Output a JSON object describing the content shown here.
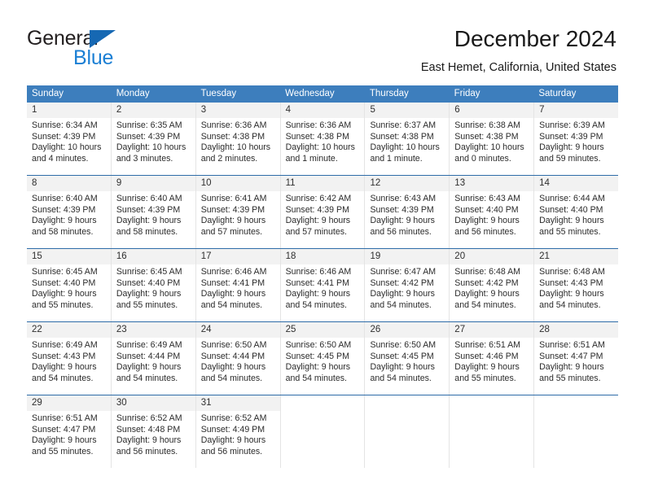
{
  "brand": {
    "name_part1": "General",
    "name_part2": "Blue",
    "triangle_icon": "blue-triangle-icon",
    "accent_color": "#1668b3",
    "accent_color_light": "#1b7fd4"
  },
  "header": {
    "title": "December 2024",
    "subtitle": "East Hemet, California, United States"
  },
  "theme": {
    "header_row_bg": "#3d7ebd",
    "header_row_text": "#ffffff",
    "daynum_bg": "#f2f2f2",
    "cell_border": "#e4e4e4",
    "week_divider": "#2e6ca8",
    "body_text": "#2b2b2b"
  },
  "weekdays": [
    "Sunday",
    "Monday",
    "Tuesday",
    "Wednesday",
    "Thursday",
    "Friday",
    "Saturday"
  ],
  "labels": {
    "sunrise_prefix": "Sunrise:",
    "sunset_prefix": "Sunset:",
    "daylight_prefix": "Daylight:"
  },
  "weeks": [
    [
      {
        "day": "1",
        "sunrise": "Sunrise: 6:34 AM",
        "sunset": "Sunset: 4:39 PM",
        "daylight_1": "Daylight: 10 hours",
        "daylight_2": "and 4 minutes."
      },
      {
        "day": "2",
        "sunrise": "Sunrise: 6:35 AM",
        "sunset": "Sunset: 4:39 PM",
        "daylight_1": "Daylight: 10 hours",
        "daylight_2": "and 3 minutes."
      },
      {
        "day": "3",
        "sunrise": "Sunrise: 6:36 AM",
        "sunset": "Sunset: 4:38 PM",
        "daylight_1": "Daylight: 10 hours",
        "daylight_2": "and 2 minutes."
      },
      {
        "day": "4",
        "sunrise": "Sunrise: 6:36 AM",
        "sunset": "Sunset: 4:38 PM",
        "daylight_1": "Daylight: 10 hours",
        "daylight_2": "and 1 minute."
      },
      {
        "day": "5",
        "sunrise": "Sunrise: 6:37 AM",
        "sunset": "Sunset: 4:38 PM",
        "daylight_1": "Daylight: 10 hours",
        "daylight_2": "and 1 minute."
      },
      {
        "day": "6",
        "sunrise": "Sunrise: 6:38 AM",
        "sunset": "Sunset: 4:38 PM",
        "daylight_1": "Daylight: 10 hours",
        "daylight_2": "and 0 minutes."
      },
      {
        "day": "7",
        "sunrise": "Sunrise: 6:39 AM",
        "sunset": "Sunset: 4:39 PM",
        "daylight_1": "Daylight: 9 hours",
        "daylight_2": "and 59 minutes."
      }
    ],
    [
      {
        "day": "8",
        "sunrise": "Sunrise: 6:40 AM",
        "sunset": "Sunset: 4:39 PM",
        "daylight_1": "Daylight: 9 hours",
        "daylight_2": "and 58 minutes."
      },
      {
        "day": "9",
        "sunrise": "Sunrise: 6:40 AM",
        "sunset": "Sunset: 4:39 PM",
        "daylight_1": "Daylight: 9 hours",
        "daylight_2": "and 58 minutes."
      },
      {
        "day": "10",
        "sunrise": "Sunrise: 6:41 AM",
        "sunset": "Sunset: 4:39 PM",
        "daylight_1": "Daylight: 9 hours",
        "daylight_2": "and 57 minutes."
      },
      {
        "day": "11",
        "sunrise": "Sunrise: 6:42 AM",
        "sunset": "Sunset: 4:39 PM",
        "daylight_1": "Daylight: 9 hours",
        "daylight_2": "and 57 minutes."
      },
      {
        "day": "12",
        "sunrise": "Sunrise: 6:43 AM",
        "sunset": "Sunset: 4:39 PM",
        "daylight_1": "Daylight: 9 hours",
        "daylight_2": "and 56 minutes."
      },
      {
        "day": "13",
        "sunrise": "Sunrise: 6:43 AM",
        "sunset": "Sunset: 4:40 PM",
        "daylight_1": "Daylight: 9 hours",
        "daylight_2": "and 56 minutes."
      },
      {
        "day": "14",
        "sunrise": "Sunrise: 6:44 AM",
        "sunset": "Sunset: 4:40 PM",
        "daylight_1": "Daylight: 9 hours",
        "daylight_2": "and 55 minutes."
      }
    ],
    [
      {
        "day": "15",
        "sunrise": "Sunrise: 6:45 AM",
        "sunset": "Sunset: 4:40 PM",
        "daylight_1": "Daylight: 9 hours",
        "daylight_2": "and 55 minutes."
      },
      {
        "day": "16",
        "sunrise": "Sunrise: 6:45 AM",
        "sunset": "Sunset: 4:40 PM",
        "daylight_1": "Daylight: 9 hours",
        "daylight_2": "and 55 minutes."
      },
      {
        "day": "17",
        "sunrise": "Sunrise: 6:46 AM",
        "sunset": "Sunset: 4:41 PM",
        "daylight_1": "Daylight: 9 hours",
        "daylight_2": "and 54 minutes."
      },
      {
        "day": "18",
        "sunrise": "Sunrise: 6:46 AM",
        "sunset": "Sunset: 4:41 PM",
        "daylight_1": "Daylight: 9 hours",
        "daylight_2": "and 54 minutes."
      },
      {
        "day": "19",
        "sunrise": "Sunrise: 6:47 AM",
        "sunset": "Sunset: 4:42 PM",
        "daylight_1": "Daylight: 9 hours",
        "daylight_2": "and 54 minutes."
      },
      {
        "day": "20",
        "sunrise": "Sunrise: 6:48 AM",
        "sunset": "Sunset: 4:42 PM",
        "daylight_1": "Daylight: 9 hours",
        "daylight_2": "and 54 minutes."
      },
      {
        "day": "21",
        "sunrise": "Sunrise: 6:48 AM",
        "sunset": "Sunset: 4:43 PM",
        "daylight_1": "Daylight: 9 hours",
        "daylight_2": "and 54 minutes."
      }
    ],
    [
      {
        "day": "22",
        "sunrise": "Sunrise: 6:49 AM",
        "sunset": "Sunset: 4:43 PM",
        "daylight_1": "Daylight: 9 hours",
        "daylight_2": "and 54 minutes."
      },
      {
        "day": "23",
        "sunrise": "Sunrise: 6:49 AM",
        "sunset": "Sunset: 4:44 PM",
        "daylight_1": "Daylight: 9 hours",
        "daylight_2": "and 54 minutes."
      },
      {
        "day": "24",
        "sunrise": "Sunrise: 6:50 AM",
        "sunset": "Sunset: 4:44 PM",
        "daylight_1": "Daylight: 9 hours",
        "daylight_2": "and 54 minutes."
      },
      {
        "day": "25",
        "sunrise": "Sunrise: 6:50 AM",
        "sunset": "Sunset: 4:45 PM",
        "daylight_1": "Daylight: 9 hours",
        "daylight_2": "and 54 minutes."
      },
      {
        "day": "26",
        "sunrise": "Sunrise: 6:50 AM",
        "sunset": "Sunset: 4:45 PM",
        "daylight_1": "Daylight: 9 hours",
        "daylight_2": "and 54 minutes."
      },
      {
        "day": "27",
        "sunrise": "Sunrise: 6:51 AM",
        "sunset": "Sunset: 4:46 PM",
        "daylight_1": "Daylight: 9 hours",
        "daylight_2": "and 55 minutes."
      },
      {
        "day": "28",
        "sunrise": "Sunrise: 6:51 AM",
        "sunset": "Sunset: 4:47 PM",
        "daylight_1": "Daylight: 9 hours",
        "daylight_2": "and 55 minutes."
      }
    ],
    [
      {
        "day": "29",
        "sunrise": "Sunrise: 6:51 AM",
        "sunset": "Sunset: 4:47 PM",
        "daylight_1": "Daylight: 9 hours",
        "daylight_2": "and 55 minutes."
      },
      {
        "day": "30",
        "sunrise": "Sunrise: 6:52 AM",
        "sunset": "Sunset: 4:48 PM",
        "daylight_1": "Daylight: 9 hours",
        "daylight_2": "and 56 minutes."
      },
      {
        "day": "31",
        "sunrise": "Sunrise: 6:52 AM",
        "sunset": "Sunset: 4:49 PM",
        "daylight_1": "Daylight: 9 hours",
        "daylight_2": "and 56 minutes."
      },
      {
        "day": "",
        "sunrise": "",
        "sunset": "",
        "daylight_1": "",
        "daylight_2": ""
      },
      {
        "day": "",
        "sunrise": "",
        "sunset": "",
        "daylight_1": "",
        "daylight_2": ""
      },
      {
        "day": "",
        "sunrise": "",
        "sunset": "",
        "daylight_1": "",
        "daylight_2": ""
      },
      {
        "day": "",
        "sunrise": "",
        "sunset": "",
        "daylight_1": "",
        "daylight_2": ""
      }
    ]
  ]
}
